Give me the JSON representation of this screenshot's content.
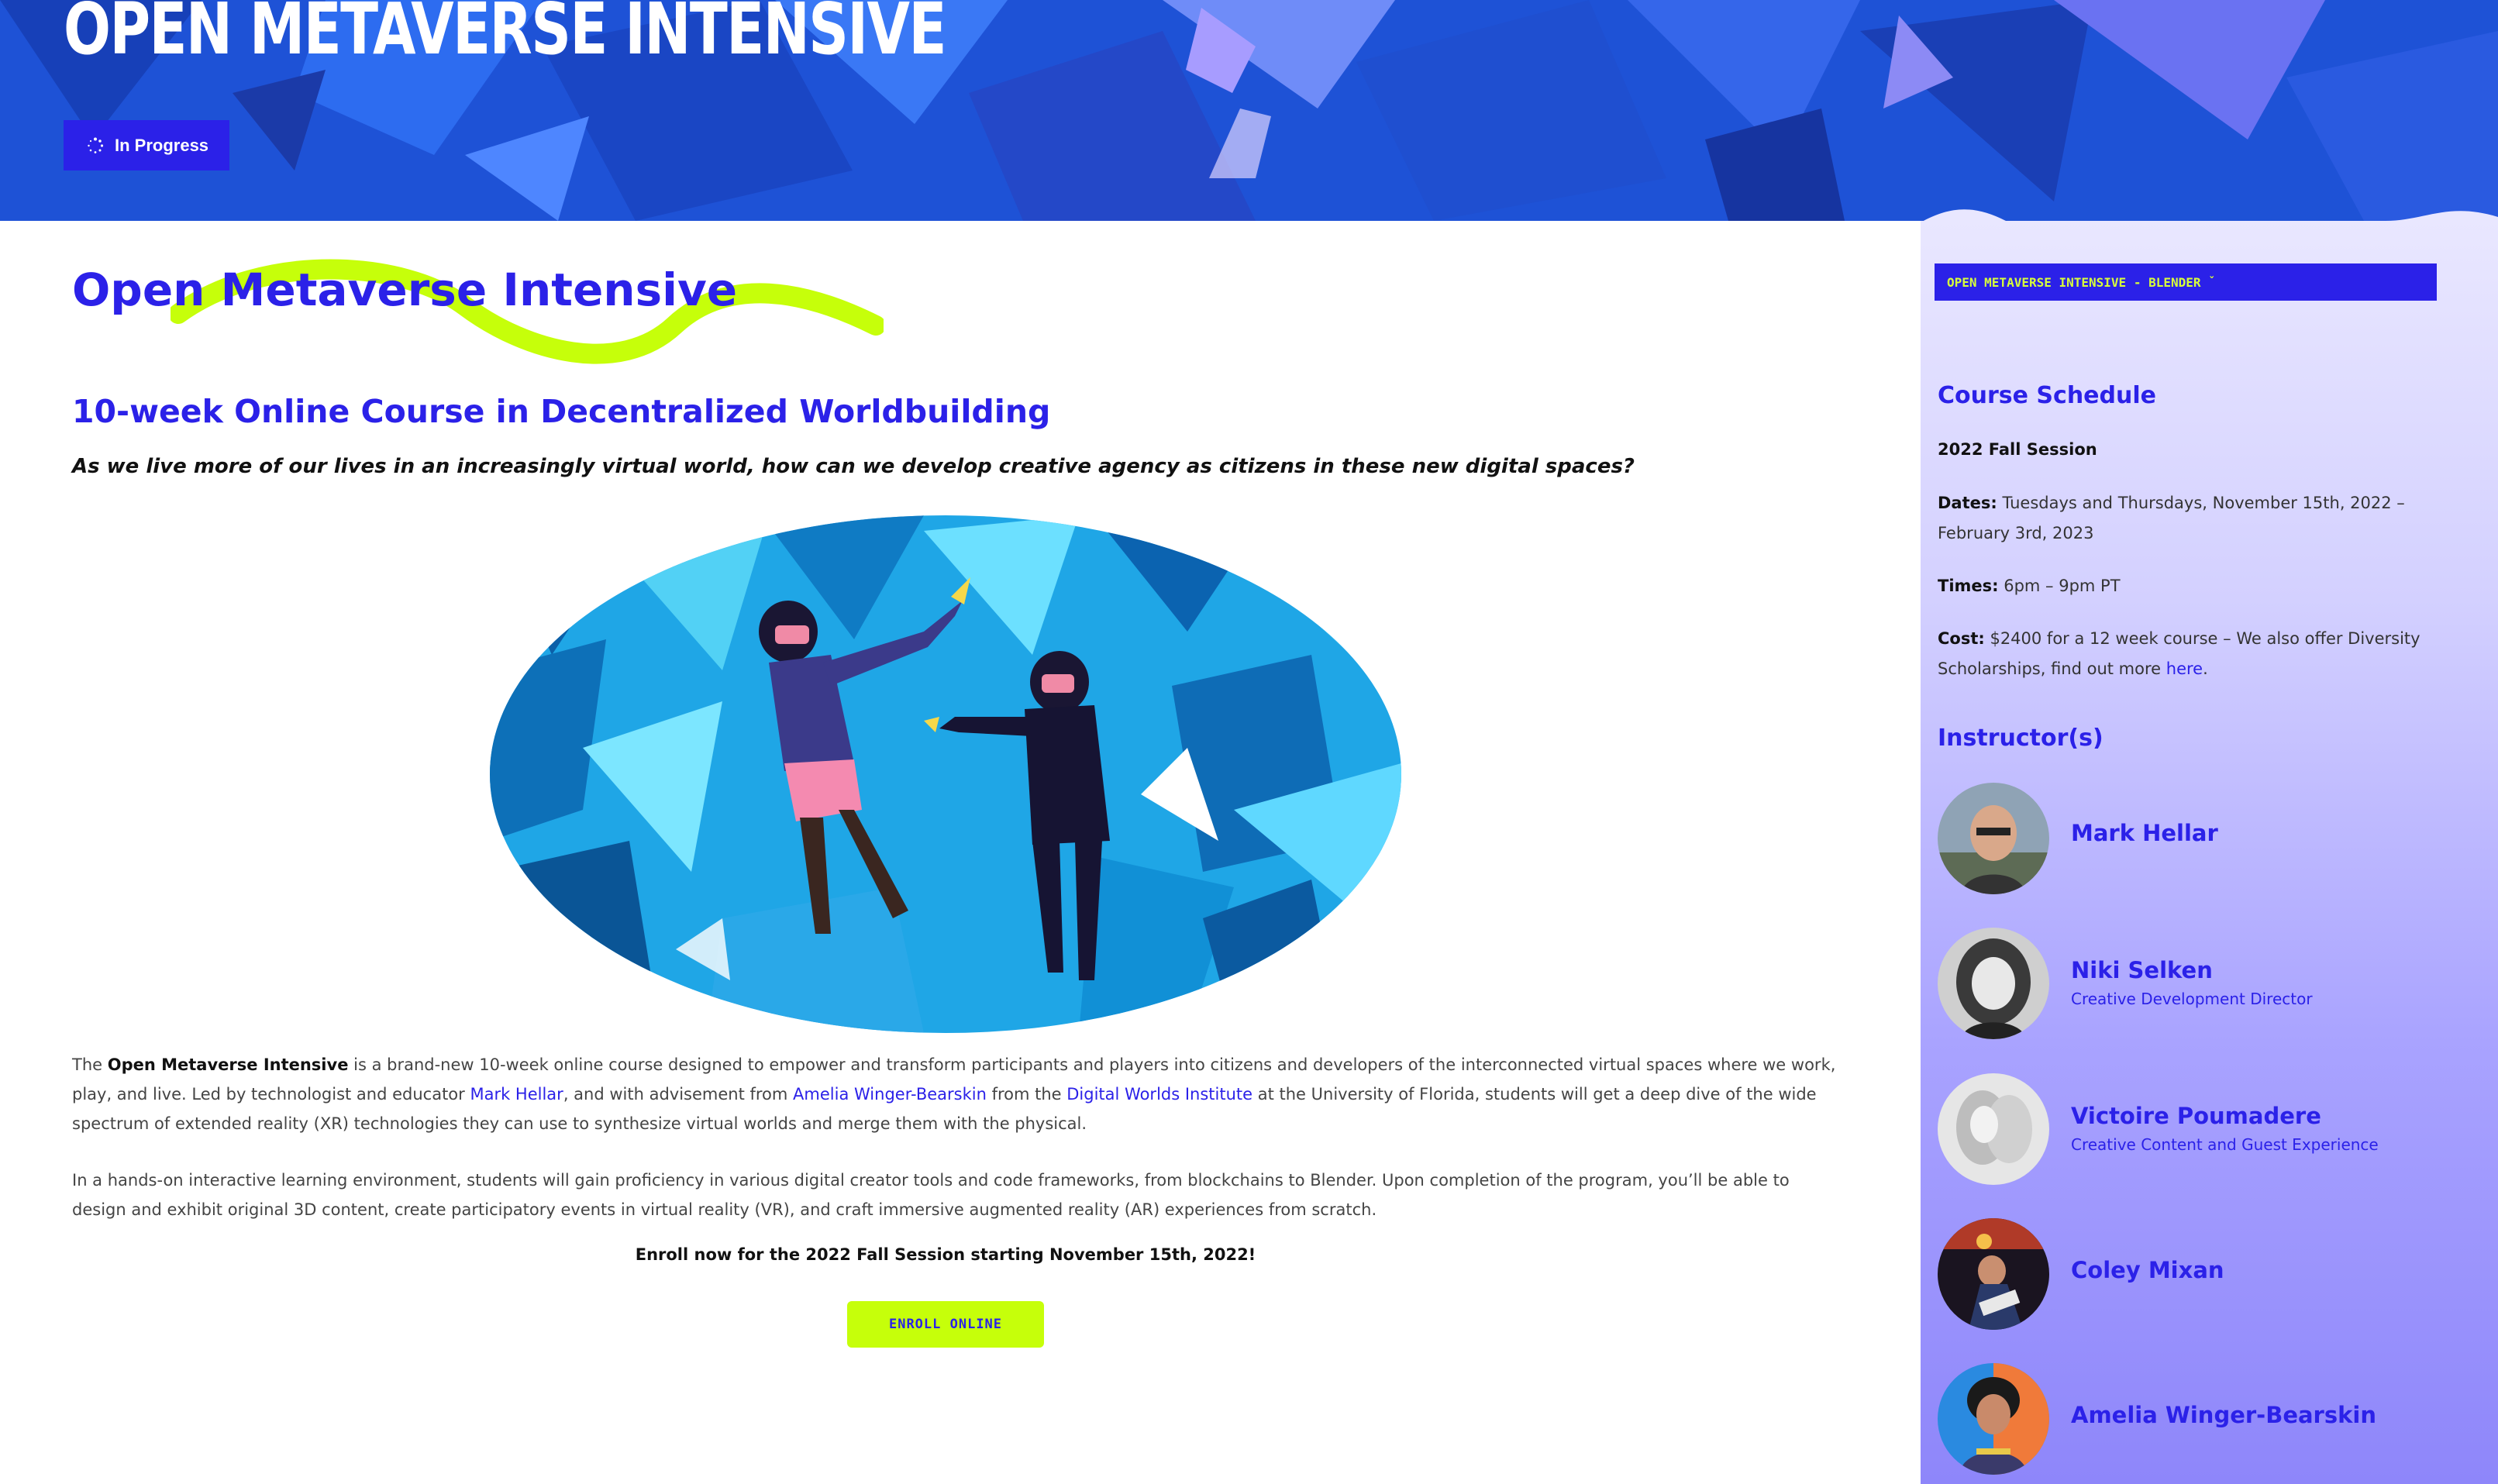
{
  "hero": {
    "title": "OPEN METAVERSE INTENSIVE",
    "status": "In Progress"
  },
  "main": {
    "title": "Open Metaverse Intensive",
    "subtitle": "10-week Online Course in Decentralized Worldbuilding",
    "tagline": "As we live more of our lives in an increasingly virtual world, how can we develop creative agency as citizens in these new digital spaces?",
    "p1": {
      "t1": "The ",
      "bold": "Open Metaverse Intensive",
      "t2": " is a brand-new 10-week online course designed to empower and transform participants and players into citizens and developers of the interconnected virtual spaces where we work, play, and live. Led by technologist and educator ",
      "link1": "Mark Hellar",
      "t3": ", and with advisement from ",
      "link2": "Amelia Winger-Bearskin",
      "t4": " from the ",
      "link3": "Digital Worlds Institute",
      "t5": " at the University of Florida, students will get a deep dive of the wide spectrum of extended reality (XR) technologies they can use to synthesize virtual worlds and merge them with the physical."
    },
    "p2": "In a hands-on interactive learning environment, students will gain proficiency in various digital creator tools and code frameworks, from blockchains to Blender. Upon completion of the program, you’ll be able to design and exhibit original 3D content, create participatory events in virtual reality (VR), and craft immersive augmented reality (AR) experiences from scratch.",
    "enroll_note": "Enroll now for the 2022 Fall Session starting November 15th, 2022!",
    "enroll_button": "ENROLL ONLINE"
  },
  "sidebar": {
    "course_select": "OPEN METAVERSE INTENSIVE - BLENDER",
    "schedule_heading": "Course Schedule",
    "session": "2022 Fall Session",
    "dates_label": "Dates:",
    "dates_value": " Tuesdays and Thursdays, November 15th, 2022 – February 3rd, 2023",
    "times_label": "Times:",
    "times_value": " 6pm – 9pm PT",
    "cost_label": "Cost:",
    "cost_value": " $2400 for a 12 week course – We also offer Diversity Scholarships, find out more ",
    "cost_link": "here",
    "cost_end": ".",
    "instructors_heading": "Instructor(s)",
    "instructors": [
      {
        "name": "Mark Hellar",
        "role": ""
      },
      {
        "name": "Niki Selken",
        "role": "Creative Development Director"
      },
      {
        "name": "Victoire Poumadere",
        "role": "Creative Content and Guest Experience"
      },
      {
        "name": "Coley Mixan",
        "role": ""
      },
      {
        "name": "Amelia Winger-Bearskin",
        "role": ""
      }
    ]
  },
  "colors": {
    "accent": "#2b21e8",
    "lime": "#c6ff0a",
    "hero_blue": "#1f55d8"
  }
}
